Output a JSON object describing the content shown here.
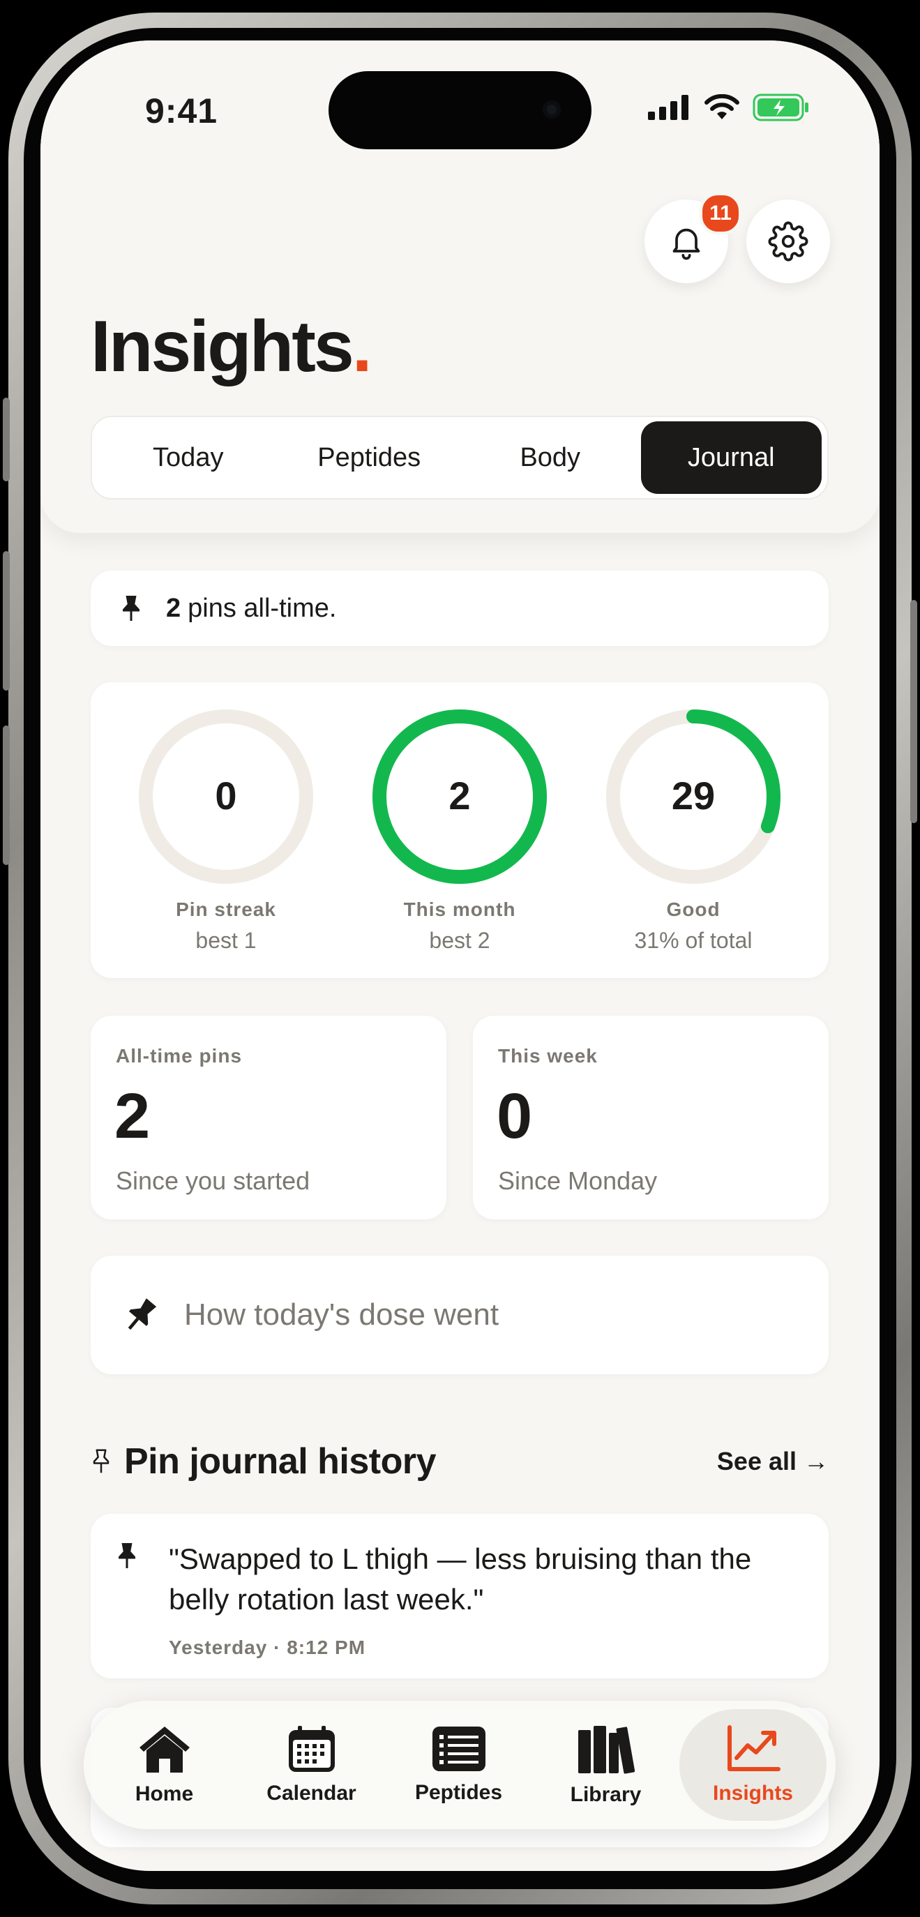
{
  "status_bar": {
    "time": "9:41"
  },
  "header": {
    "title": "Insights",
    "title_dot": ".",
    "notification_count": "11",
    "accent_color": "#e8481c",
    "tabs": [
      {
        "label": "Today",
        "active": false
      },
      {
        "label": "Peptides",
        "active": false
      },
      {
        "label": "Body",
        "active": false
      },
      {
        "label": "Journal",
        "active": true
      }
    ]
  },
  "pins_summary": {
    "count": "2",
    "text": "pins all-time."
  },
  "rings": [
    {
      "value": "0",
      "label": "Pin streak",
      "sub": "best 1",
      "progress": 0,
      "color": "#12b84e"
    },
    {
      "value": "2",
      "label": "This month",
      "sub": "best 2",
      "progress": 1.0,
      "color": "#12b84e"
    },
    {
      "value": "29",
      "label": "Good",
      "sub": "31% of total",
      "progress": 0.31,
      "color": "#12b84e"
    }
  ],
  "stats": [
    {
      "label": "All-time pins",
      "value": "2",
      "sub": "Since you started"
    },
    {
      "label": "This week",
      "value": "0",
      "sub": "Since Monday"
    }
  ],
  "dose_prompt": {
    "placeholder": "How today's dose went"
  },
  "history": {
    "title": "Pin journal history",
    "see_all": "See all",
    "see_all_arrow": "→",
    "entries": [
      {
        "quote": "\"Swapped to L thigh — less bruising than the belly rotation last week.\"",
        "meta": "Yesterday · 8:12 PM"
      }
    ]
  },
  "tabbar": {
    "items": [
      {
        "label": "Home",
        "icon": "home-icon",
        "active": false
      },
      {
        "label": "Calendar",
        "icon": "calendar-icon",
        "active": false
      },
      {
        "label": "Peptides",
        "icon": "list-icon",
        "active": false
      },
      {
        "label": "Library",
        "icon": "books-icon",
        "active": false
      },
      {
        "label": "Insights",
        "icon": "chart-icon",
        "active": true
      }
    ]
  }
}
